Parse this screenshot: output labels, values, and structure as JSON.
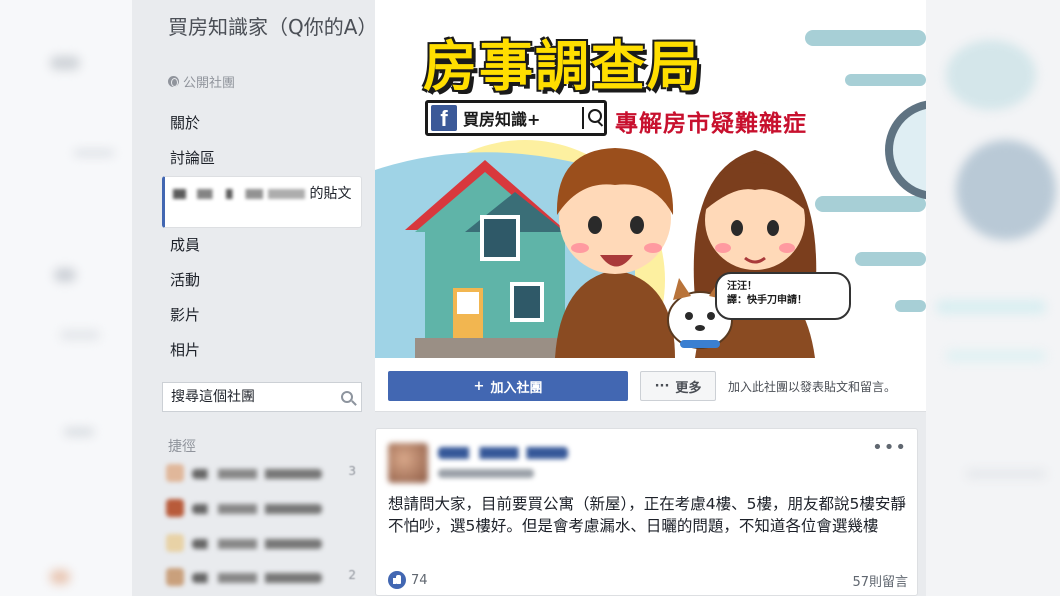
{
  "group": {
    "title": "買房知識家（Q你的A）",
    "privacy": "公開社團"
  },
  "nav": {
    "items": [
      "關於",
      "討論區",
      "成員",
      "活動",
      "影片",
      "相片"
    ],
    "active_suffix": "的貼文"
  },
  "search": {
    "placeholder": "搜尋這個社團"
  },
  "shortcuts": {
    "title": "捷徑",
    "counts": [
      "3",
      "2"
    ]
  },
  "cover": {
    "title": "房事調查局",
    "fb_logo": "f",
    "fb_search_text": "買房知識+",
    "subtitle": "專解房市疑難雜症",
    "bubble_line1": "汪汪！",
    "bubble_line2": "譯：快手刀申請！"
  },
  "actions": {
    "join_label": "加入社團",
    "join_icon": "+",
    "more_label": "更多",
    "more_icon": "···",
    "hint": "加入此社團以發表貼文和留言。"
  },
  "post": {
    "text": "想請問大家，目前要買公寓（新屋），正在考慮4樓、5樓，朋友都說5樓安靜不怕吵，選5樓好。但是會考慮漏水、日曬的問題，不知道各位會選幾樓",
    "likes": "74",
    "comments": "57則留言",
    "menu": "•••"
  },
  "colors": {
    "brand_blue": "#4267b2",
    "cover_yellow": "#ffde00",
    "cover_red": "#c8102e",
    "page_bg": "#e9ebee"
  }
}
